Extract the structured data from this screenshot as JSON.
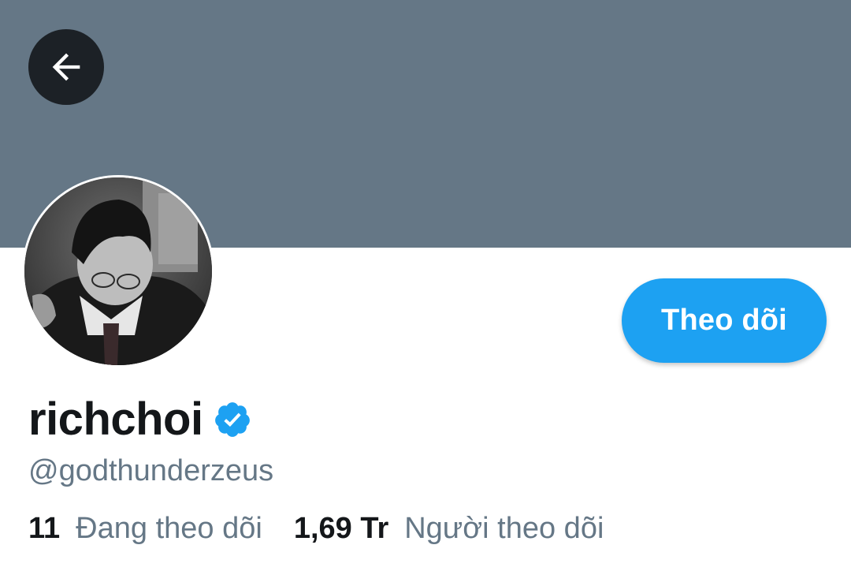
{
  "colors": {
    "banner": "#657786",
    "accent": "#1da1f2",
    "text_primary": "#14171a",
    "text_secondary": "#657786"
  },
  "icons": {
    "back": "arrow-left-icon",
    "verified": "verified-badge-icon"
  },
  "profile": {
    "display_name": "richchoi",
    "verified": true,
    "handle": "@godthunderzeus"
  },
  "actions": {
    "follow_label": "Theo dõi"
  },
  "stats": {
    "following_count": "11",
    "following_label": "Đang theo dõi",
    "followers_count": "1,69 Tr",
    "followers_label": "Người theo dõi"
  }
}
